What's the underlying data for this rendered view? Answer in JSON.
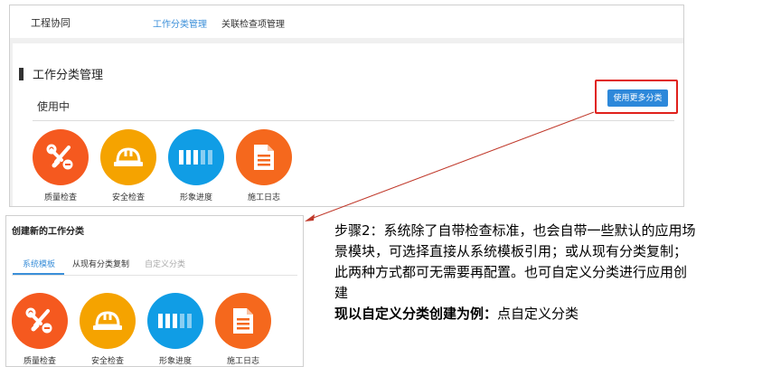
{
  "top": {
    "app_title": "工程协同",
    "tabs": [
      {
        "label": "工作分类管理",
        "active": true
      },
      {
        "label": "关联检查项管理",
        "active": false
      }
    ],
    "section_title": "工作分类管理",
    "sub_title": "使用中",
    "more_button": "使用更多分类",
    "apps": [
      {
        "label": "质量检查",
        "icon": "wrench-screwdriver-icon",
        "color": "#f5591f"
      },
      {
        "label": "安全检查",
        "icon": "hard-hat-icon",
        "color": "#f5a300"
      },
      {
        "label": "形象进度",
        "icon": "progress-bars-icon",
        "color": "#109de5"
      },
      {
        "label": "施工日志",
        "icon": "document-icon",
        "color": "#f5681d"
      }
    ]
  },
  "bottom": {
    "title": "创建新的工作分类",
    "tabs": [
      {
        "label": "系统模板",
        "state": "active"
      },
      {
        "label": "从现有分类复制",
        "state": "normal"
      },
      {
        "label": "自定义分类",
        "state": "muted"
      }
    ],
    "apps": [
      {
        "label": "质量检查",
        "icon": "wrench-screwdriver-icon"
      },
      {
        "label": "安全检查",
        "icon": "hard-hat-icon"
      },
      {
        "label": "形象进度",
        "icon": "progress-bars-icon"
      },
      {
        "label": "施工日志",
        "icon": "document-icon"
      }
    ]
  },
  "instruction": {
    "line1": "步骤2：系统除了自带检查标准，也会自带一些默认的应用场",
    "line2": "景模块，可选择直接从系统模板引用；或从现有分类复制；",
    "line3": "此两种方式都可无需要再配置。也可自定义分类进行应用创",
    "line4": "建",
    "emphasis": "现以自定义分类创建为例：",
    "tail": "点自定义分类"
  },
  "colors": {
    "accent": "#3b8fd9",
    "button": "#2d88da",
    "highlight_box": "#e0201b",
    "arrow": "#c0392b"
  }
}
